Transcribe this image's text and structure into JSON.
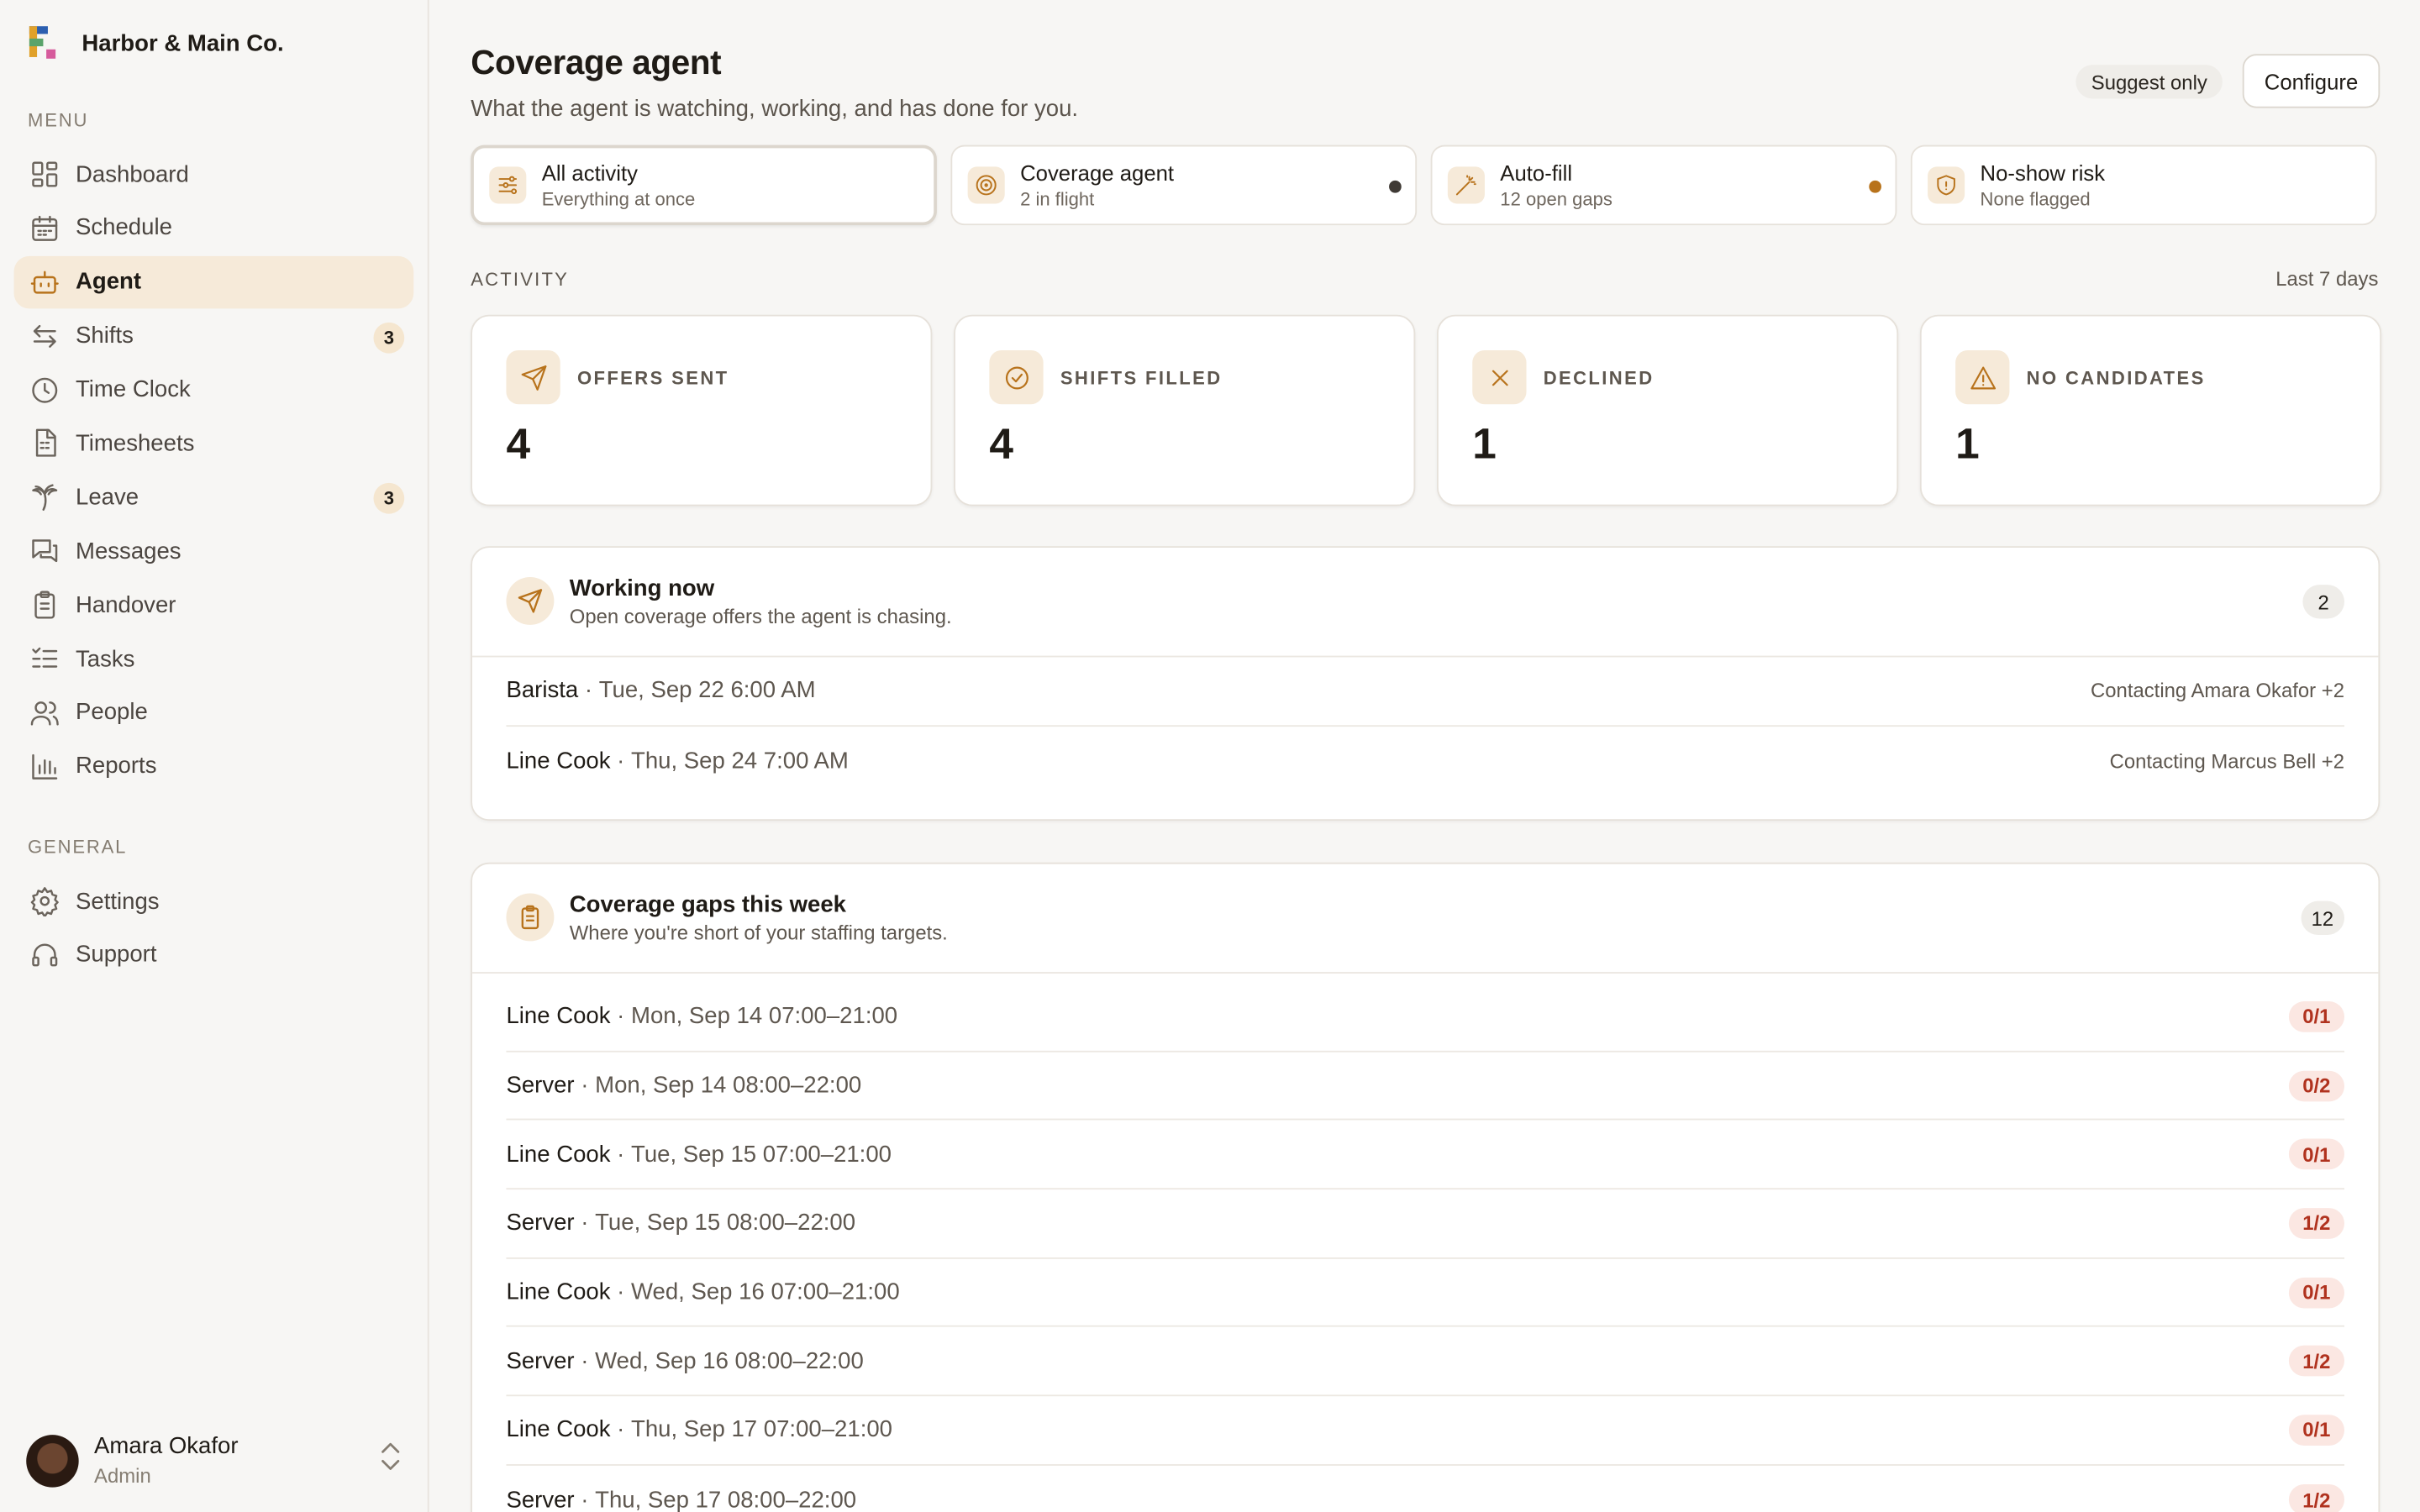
{
  "brand": {
    "name": "Harbor & Main Co."
  },
  "sidebar": {
    "menu_label": "MENU",
    "items": [
      {
        "label": "Dashboard",
        "icon": "dashboard-icon",
        "active": false
      },
      {
        "label": "Schedule",
        "icon": "calendar-icon",
        "active": false
      },
      {
        "label": "Agent",
        "icon": "bot-icon",
        "active": true
      },
      {
        "label": "Shifts",
        "icon": "swap-icon",
        "active": false,
        "badge": "3"
      },
      {
        "label": "Time Clock",
        "icon": "clock-icon",
        "active": false
      },
      {
        "label": "Timesheets",
        "icon": "timesheet-icon",
        "active": false
      },
      {
        "label": "Leave",
        "icon": "palm-tree-icon",
        "active": false,
        "badge": "3"
      },
      {
        "label": "Messages",
        "icon": "messages-icon",
        "active": false
      },
      {
        "label": "Handover",
        "icon": "clipboard-icon",
        "active": false
      },
      {
        "label": "Tasks",
        "icon": "checklist-icon",
        "active": false
      },
      {
        "label": "People",
        "icon": "people-icon",
        "active": false
      },
      {
        "label": "Reports",
        "icon": "bar-chart-icon",
        "active": false
      }
    ],
    "general_label": "GENERAL",
    "general_items": [
      {
        "label": "Settings",
        "icon": "gear-icon"
      },
      {
        "label": "Support",
        "icon": "headset-icon"
      }
    ]
  },
  "user": {
    "name": "Amara Okafor",
    "role": "Admin"
  },
  "header": {
    "title": "Coverage agent",
    "subtitle": "What the agent is watching, working, and has done for you.",
    "mode": "Suggest only",
    "configure_label": "Configure"
  },
  "filters": [
    {
      "title": "All activity",
      "sub": "Everything at once",
      "icon": "sliders-icon",
      "selected": true
    },
    {
      "title": "Coverage agent",
      "sub": "2 in flight",
      "icon": "target-icon",
      "dot": "#3f3a35"
    },
    {
      "title": "Auto-fill",
      "sub": "12 open gaps",
      "icon": "magic-wand-icon",
      "dot": "#b8731c"
    },
    {
      "title": "No-show risk",
      "sub": "None flagged",
      "icon": "shield-icon"
    }
  ],
  "activity": {
    "label": "ACTIVITY",
    "range": "Last 7 days",
    "stats": [
      {
        "label": "OFFERS SENT",
        "value": "4",
        "icon": "send-icon"
      },
      {
        "label": "SHIFTS FILLED",
        "value": "4",
        "icon": "check-circle-icon"
      },
      {
        "label": "DECLINED",
        "value": "1",
        "icon": "x-icon"
      },
      {
        "label": "NO CANDIDATES",
        "value": "1",
        "icon": "warning-icon"
      }
    ]
  },
  "working_now": {
    "title": "Working now",
    "subtitle": "Open coverage offers the agent is chasing.",
    "count": "2",
    "rows": [
      {
        "role": "Barista",
        "detail": "Tue, Sep 22 6:00 AM",
        "status": "Contacting Amara Okafor +2"
      },
      {
        "role": "Line Cook",
        "detail": "Thu, Sep 24 7:00 AM",
        "status": "Contacting Marcus Bell +2"
      }
    ]
  },
  "gaps": {
    "title": "Coverage gaps this week",
    "subtitle": "Where you're short of your staffing targets.",
    "count": "12",
    "rows": [
      {
        "role": "Line Cook",
        "detail": "Mon, Sep 14 07:00–21:00",
        "ratio": "0/1"
      },
      {
        "role": "Server",
        "detail": "Mon, Sep 14 08:00–22:00",
        "ratio": "0/2"
      },
      {
        "role": "Line Cook",
        "detail": "Tue, Sep 15 07:00–21:00",
        "ratio": "0/1"
      },
      {
        "role": "Server",
        "detail": "Tue, Sep 15 08:00–22:00",
        "ratio": "1/2"
      },
      {
        "role": "Line Cook",
        "detail": "Wed, Sep 16 07:00–21:00",
        "ratio": "0/1"
      },
      {
        "role": "Server",
        "detail": "Wed, Sep 16 08:00–22:00",
        "ratio": "1/2"
      },
      {
        "role": "Line Cook",
        "detail": "Thu, Sep 17 07:00–21:00",
        "ratio": "0/1"
      },
      {
        "role": "Server",
        "detail": "Thu, Sep 17 08:00–22:00",
        "ratio": "1/2"
      }
    ]
  },
  "colors": {
    "accent": "#b8731c",
    "accent_soft": "#f6ead9",
    "danger_text": "#b0321e",
    "danger_bg": "#fbe7e2"
  }
}
